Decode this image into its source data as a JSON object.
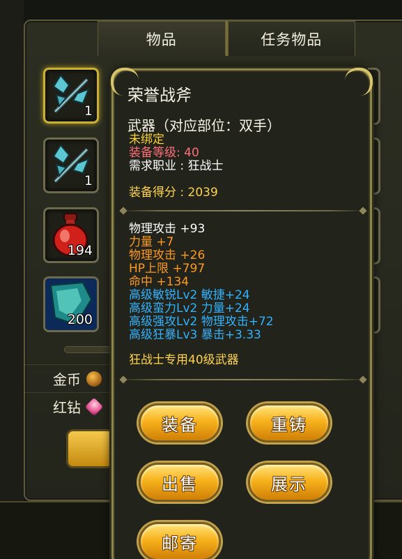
{
  "tabs": [
    {
      "label": "物品"
    },
    {
      "label": "任务物品"
    }
  ],
  "inventory": {
    "slots": [
      {
        "icon": "battle-axe-icon",
        "count": "1",
        "selected": true
      },
      {
        "icon": "battle-axe-icon",
        "count": "1",
        "selected": false
      },
      {
        "icon": "red-potion-icon",
        "count": "194",
        "selected": false
      },
      {
        "icon": "jade-shard-icon",
        "count": "200",
        "selected": false
      }
    ]
  },
  "currency": {
    "gold_label": "金币",
    "gold_icon": "gold-coin-icon",
    "diamond_label": "红钻",
    "diamond_icon": "red-diamond-icon"
  },
  "tooltip": {
    "title": "荣誉战斧",
    "type_line": "武器（对应部位：双手）",
    "bind_status": "未绑定",
    "level_label": "装备等级",
    "level_value": ": 40",
    "class_req": "需求职业 : 狂战士",
    "score_line": "装备得分 : 2039",
    "base_stats": [
      "物理攻击 +93"
    ],
    "bonus_stats": [
      "力量 +7",
      "物理攻击 +26",
      "HP上限 +797",
      "命中 +134"
    ],
    "special_stats": [
      "高级敏锐Lv2 敏捷+24",
      "高级蛮力Lv2 力量+24",
      "高级强攻Lv2 物理攻击+72",
      "高级狂暴Lv3 暴击+3.33"
    ],
    "description": "狂战士专用40级武器"
  },
  "actions": {
    "equip": "装备",
    "reforge": "重铸",
    "sell": "出售",
    "display": "展示",
    "mail": "邮寄"
  },
  "colors": {
    "yellow": "#f8d030",
    "pink": "#ff6f7a",
    "orange": "#ff9a1e",
    "blue": "#2fb3ff",
    "button_gold": "#f7b21c"
  }
}
